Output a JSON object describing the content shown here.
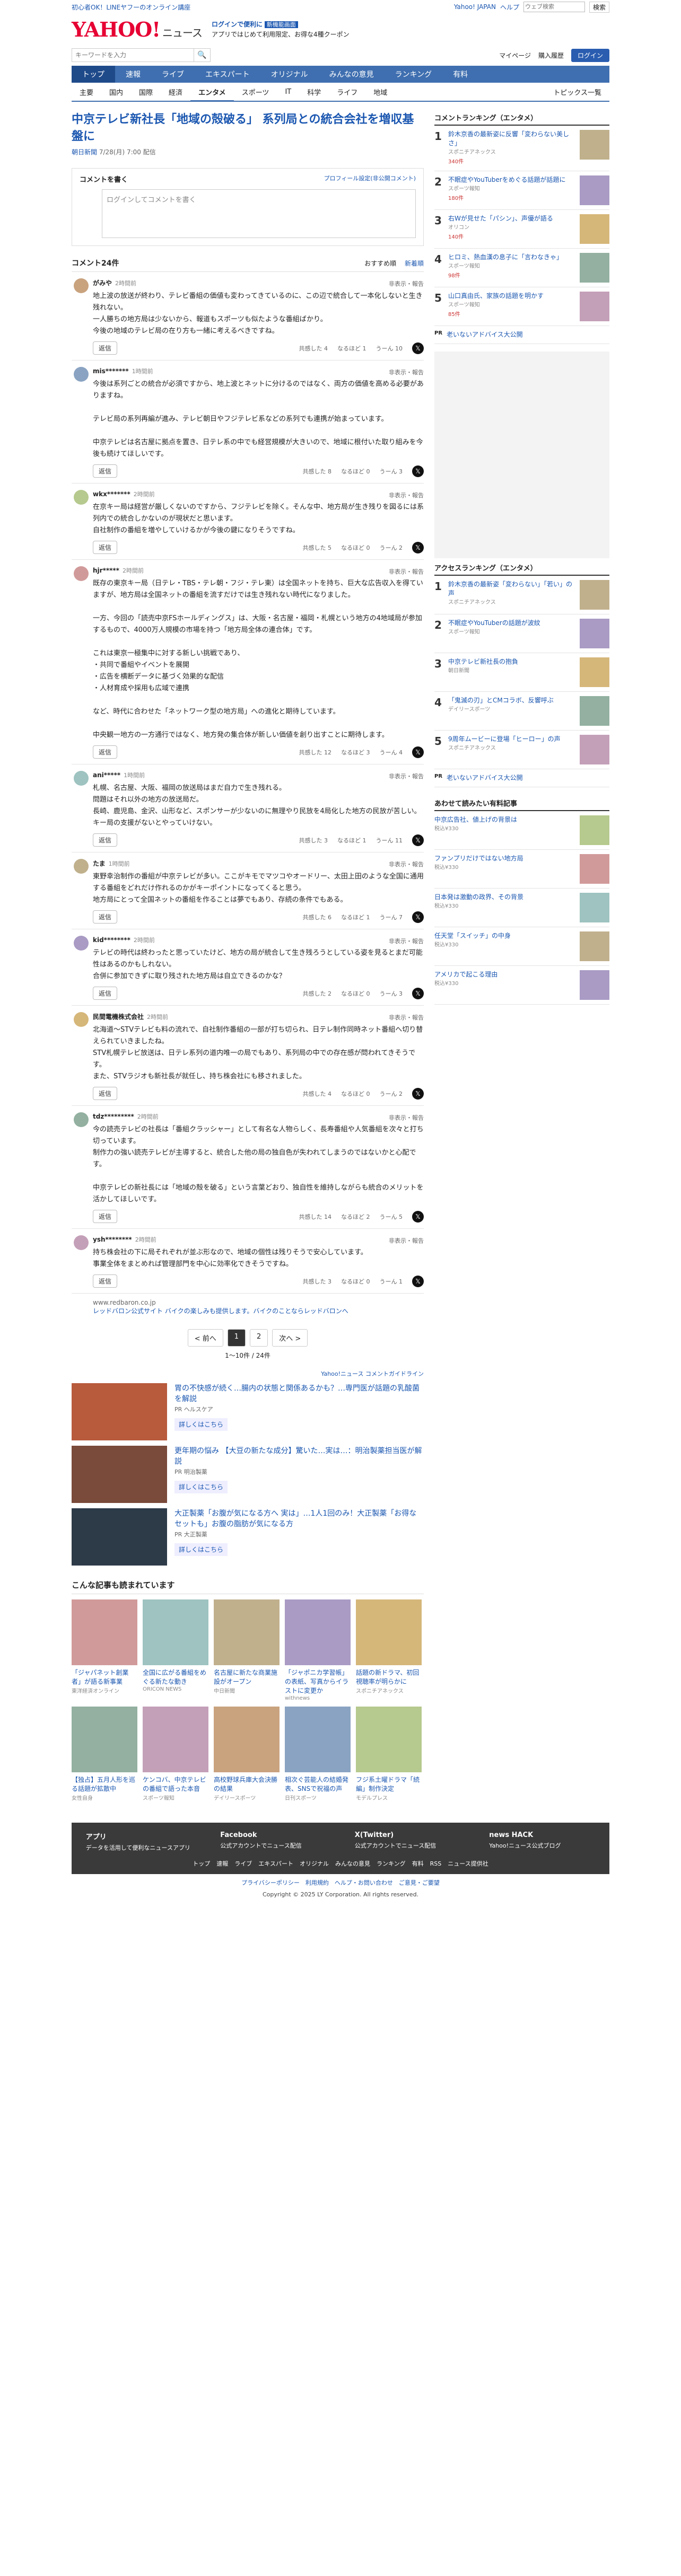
{
  "topbar": {
    "left": [
      "初心者OK！LINEヤフーのオンライン講座"
    ],
    "right": [
      "Yahoo! JAPAN",
      "ヘルプ"
    ],
    "search_placeholder": "ウェブ検索",
    "search_btn": "検索"
  },
  "logo": {
    "main": "YAHOO!",
    "sub": "ニュース",
    "tagline": "JAPAN"
  },
  "promo": {
    "line1": "ログインで便利に",
    "line2": "アプリではじめて利用限定、お得な4種クーポン",
    "badge": "新機能画面"
  },
  "search": {
    "placeholder": "キーワードを入力",
    "mypage": "マイページ",
    "buy": "購入履歴",
    "login": "ログイン"
  },
  "nav1": [
    "トップ",
    "速報",
    "ライブ",
    "エキスパート",
    "オリジナル",
    "みんなの意見",
    "ランキング",
    "有料"
  ],
  "nav2": [
    "主要",
    "国内",
    "国際",
    "経済",
    "エンタメ",
    "スポーツ",
    "IT",
    "科学",
    "ライフ",
    "地域"
  ],
  "nav2_active": "エンタメ",
  "topics": "トピックス一覧",
  "article": {
    "title": "中京テレビ新社長「地域の殻破る」 系列局との統合会社を増収基盤に",
    "source": "朝日新聞",
    "time": "7/28(月) 7:00 配信"
  },
  "comment_box": {
    "label": "コメントを書く",
    "profile_link": "プロフィール設定(非公開コメント)",
    "login_prompt": "ログインしてコメントを書く"
  },
  "comments_header": {
    "title": "コメント24件",
    "sort_rec": "おすすめ順",
    "sort_new": "新着順"
  },
  "comments": [
    {
      "name": "がみや",
      "time": "2時間前",
      "body": "地上波の放送が終わり、テレビ番組の価値も変わってきているのに、この辺で統合して一本化しないと生き残れない。\n一人勝ちの地方局は少ないから、報道もスポーツも似たような番組ばかり。\n今後の地域のテレビ局の在り方も一緒に考えるべきですね。",
      "likes": "4",
      "agree": "1",
      "hm": "10"
    },
    {
      "name": "mis*******",
      "time": "1時間前",
      "body": "今後は系列ごとの統合が必須ですから、地上波とネットに分けるのではなく、両方の価値を高める必要がありますね。\n\nテレビ局の系列再編が進み、テレビ朝日やフジテレビ系などの系列でも連携が始まっています。\n\n中京テレビは名古屋に拠点を置き、日テレ系の中でも経営規模が大きいので、地域に根付いた取り組みを今後も続けてほしいです。",
      "likes": "8",
      "agree": "0",
      "hm": "3"
    },
    {
      "name": "wkx*******",
      "time": "2時間前",
      "body": "在京キー局は経営が厳しくないのですから、フジテレビを除く。そんな中、地方局が生き残りを図るには系列内での統合しかないのが現状だと思います。\n自社制作の番組を増やしていけるかが今後の鍵になりそうですね。",
      "likes": "5",
      "agree": "0",
      "hm": "2"
    },
    {
      "name": "hjr*****",
      "time": "2時間前",
      "body": "既存の東京キー局（日テレ・TBS・テレ朝・フジ・テレ東）は全国ネットを持ち、巨大な広告収入を得ていますが、地方局は全国ネットの番組を流すだけでは生き残れない時代になりました。\n\n一方、今回の「読売中京FSホールディングス」は、大阪・名古屋・福岡・札幌という地方の4地域局が参加するもので、4000万人規模の市場を持つ「地方局全体の連合体」です。\n\nこれは東京一極集中に対する新しい挑戦であり、\n・共同で番組やイベントを展開\n・広告を横断データに基づく効果的な配信\n・人材育成や採用も広域で連携\n\nなど、時代に合わせた「ネットワーク型の地方局」への進化と期待しています。\n\n中央観一地方の一方通行ではなく、地方発の集合体が新しい価値を創り出すことに期待します。",
      "likes": "12",
      "agree": "3",
      "hm": "4"
    },
    {
      "name": "ani*****",
      "time": "1時間前",
      "body": "札幌、名古屋、大阪、福岡の放送局はまだ自力で生き残れる。\n問題はそれ以外の地方の放送局だ。\n長崎、鹿児島、金沢、山形など、スポンサーが少ないのに無理やり民放を4局化した地方の民放が苦しい。キー局の支援がないとやっていけない。",
      "likes": "3",
      "agree": "1",
      "hm": "11"
    },
    {
      "name": "たま",
      "time": "1時間前",
      "body": "東野幸治制作の番組が中京テレビが多い。ここがキモでマツコやオードリー、太田上田のような全国に通用する番組をどれだけ作れるのかがキーポイントになってくると思う。\n地方局にとって全国ネットの番組を作ることは夢でもあり、存続の条件でもある。",
      "likes": "6",
      "agree": "1",
      "hm": "7"
    },
    {
      "name": "kid********",
      "time": "2時間前",
      "body": "テレビの時代は終わったと思っていたけど、地方の局が統合して生き残ろうとしている姿を見るとまだ可能性はあるのかもしれない。\n合併に参加できずに取り残された地方局は自立できるのかな？",
      "likes": "2",
      "agree": "0",
      "hm": "3"
    },
    {
      "name": "民間電機株式会社",
      "time": "2時間前",
      "body": "北海道〜STVテレビも料の流れで、自社制作番組の一部が打ち切られ、日テレ制作同時ネット番組へ切り替えられていきましたね。\nSTV札幌テレビ放送は、日テレ系列の道内唯一の局でもあり、系列局の中での存在感が問われてきそうです。\nまた、STVラジオも新社長が就任し、持ち株会社にも移されました。",
      "likes": "4",
      "agree": "0",
      "hm": "2"
    },
    {
      "name": "tdz*********",
      "time": "2時間前",
      "body": "今の読売テレビの社長は「番組クラッシャー」として有名な人物らしく、長寿番組や人気番組を次々と打ち切っています。\n制作力の強い読売テレビが主導すると、統合した他の局の独自色が失われてしまうのではないかと心配です。\n\n中京テレビの新社長には「地域の殻を破る」という言葉どおり、独自性を維持しながらも統合のメリットを活かしてほしいです。",
      "likes": "14",
      "agree": "2",
      "hm": "5"
    },
    {
      "name": "ysh********",
      "time": "2時間前",
      "body": "持ち株会社の下に局それぞれが並ぶ形なので、地域の個性は残りそうで安心しています。\n事業全体をまとめれば管理部門を中心に効率化できそうですね。",
      "likes": "3",
      "agree": "0",
      "hm": "1"
    }
  ],
  "ad_link": {
    "label": "www.redbaron.co.jp",
    "text": "レッドバロン公式サイト バイクの楽しみも提供します。バイクのことならレッドバロンへ"
  },
  "pager": {
    "prev": "< 前へ",
    "pages": [
      "1",
      "2"
    ],
    "next": "次へ >",
    "count": "1〜10件 / 24件"
  },
  "ad_label": "Yahoo!ニュース コメントガイドライン",
  "ads": [
    {
      "title": "胃の不快感が続く…腸内の状態と関係あるかも？…専門医が話題の乳酸菌を解説",
      "src": "PR ヘルスケア",
      "more": "詳しくはこちら"
    },
    {
      "title": "更年期の悩み 【大豆の新たな成分】驚いた…実は…：明治製薬担当医が解説",
      "src": "PR 明治製薬",
      "more": "詳しくはこちら"
    },
    {
      "title": "大正製薬「お腹が気になる方へ 実は」…1人1回のみ！大正製薬「お得なセットも」お腹の脂肪が気になる方",
      "src": "PR 大正製薬",
      "more": "詳しくはこちら"
    }
  ],
  "grid_title": "こんな記事も読まれています",
  "grid": [
    {
      "t": "「ジャパネット創業者」が語る新事業",
      "s": "東洋経済オンライン"
    },
    {
      "t": "全国に広がる番組をめぐる新たな動き",
      "s": "ORICON NEWS"
    },
    {
      "t": "名古屋に新たな商業施設がオープン",
      "s": "中日新聞"
    },
    {
      "t": "「ジャポニカ学習帳」の表紙、写真からイラストに変更か",
      "s": "withnews"
    },
    {
      "t": "話題の新ドラマ、初回視聴率が明らかに",
      "s": "スポニチアネックス"
    },
    {
      "t": "【独占】五月人形を巡る話題が拡散中",
      "s": "女性自身"
    },
    {
      "t": "ケンコバ、中京テレビの番組で語った本音",
      "s": "スポーツ報知"
    },
    {
      "t": "高校野球兵庫大会決勝の結果",
      "s": "デイリースポーツ"
    },
    {
      "t": "相次ぐ芸能人の結婚発表、SNSで祝福の声",
      "s": "日刊スポーツ"
    },
    {
      "t": "フジ系土曜ドラマ「続編」制作決定",
      "s": "モデルプレス"
    }
  ],
  "side": {
    "rank_title": "コメントランキング（エンタメ）",
    "rank": [
      {
        "n": "1",
        "t": "鈴木京香の最新姿に反響「変わらない美しさ」",
        "s": "スポニチアネックス",
        "c": "340件"
      },
      {
        "n": "2",
        "t": "不眠症やYouTuberをめぐる話題が話題に",
        "s": "スポーツ報知",
        "c": "180件"
      },
      {
        "n": "3",
        "t": "右Wが見せた「パシン」、声優が語る",
        "s": "オリコン",
        "c": "140件"
      },
      {
        "n": "4",
        "t": "ヒロミ、熱血漢の息子に「言わなきゃ」",
        "s": "スポーツ報知",
        "c": "98件"
      },
      {
        "n": "5",
        "t": "山口真由氏、家族の話題を明かす",
        "s": "スポーツ報知",
        "c": "85件"
      }
    ],
    "pr": "老いないアドバイス大公開",
    "access_title": "アクセスランキング（エンタメ）",
    "access": [
      {
        "n": "1",
        "t": "鈴木京香の最新姿「変わらない」「若い」の声",
        "s": "スポニチアネックス"
      },
      {
        "n": "2",
        "t": "不眠症やYouTuberの話題が波紋",
        "s": "スポーツ報知"
      },
      {
        "n": "3",
        "t": "中京テレビ新社長の抱負",
        "s": "朝日新聞"
      },
      {
        "n": "4",
        "t": "「鬼滅の刃」とCMコラボ、反響呼ぶ",
        "s": "デイリースポーツ"
      },
      {
        "n": "5",
        "t": "9周年ムービーに登場「ヒーロー」の声",
        "s": "スポニチアネックス"
      }
    ],
    "pr2": "老いないアドバイス大公開",
    "shop_title": "あわせて読みたい有料記事",
    "shop": [
      {
        "t": "中京広告社、値上げの背景は",
        "p": "税込¥330"
      },
      {
        "t": "ファンプリだけではない地方局",
        "p": "税込¥330"
      },
      {
        "t": "日本発は激動の政界、その背景",
        "p": "税込¥330"
      },
      {
        "t": "任天堂「スイッチ」の中身",
        "p": "税込¥330"
      },
      {
        "t": "アメリカで起こる理由",
        "p": "税込¥330"
      }
    ]
  },
  "footer": {
    "cols": [
      {
        "h": "アプリ",
        "t": "データを活用して便利なニュースアプリ"
      },
      {
        "h": "Facebook",
        "t": "公式アカウントでニュース配信"
      },
      {
        "h": "X(Twitter)",
        "t": "公式アカウントでニュース配信"
      },
      {
        "h": "news HACK",
        "t": "Yahoo!ニュース公式ブログ"
      }
    ],
    "links": [
      "トップ",
      "速報",
      "ライブ",
      "エキスパート",
      "オリジナル",
      "みんなの意見",
      "ランキング",
      "有料",
      "RSS",
      "ニュース提供社"
    ],
    "bottom": "プライバシーポリシー　利用規約　ヘルプ・お問い合わせ　ご意見・ご要望",
    "copy": "Copyright © 2025 LY Corporation. All rights reserved."
  }
}
